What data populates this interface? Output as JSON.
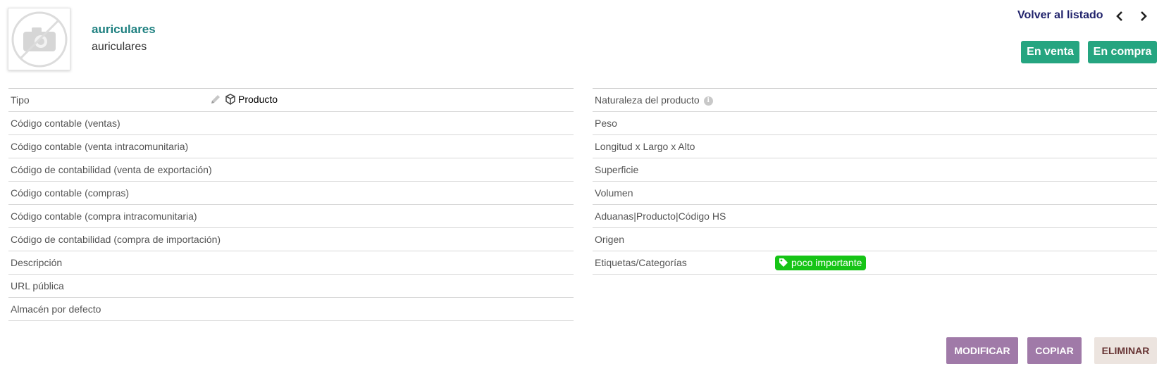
{
  "header": {
    "ref": "auriculares",
    "label": "auriculares",
    "back_link": "Volver al listado",
    "status_sell": "En venta",
    "status_buy": "En compra"
  },
  "left_fields": [
    {
      "label": "Tipo",
      "value": "Producto"
    },
    {
      "label": "Código contable (ventas)",
      "value": ""
    },
    {
      "label": "Código contable (venta intracomunitaria)",
      "value": ""
    },
    {
      "label": "Código de contabilidad (venta de exportación)",
      "value": ""
    },
    {
      "label": "Código contable (compras)",
      "value": ""
    },
    {
      "label": "Código contable (compra intracomunitaria)",
      "value": ""
    },
    {
      "label": "Código de contabilidad (compra de importación)",
      "value": ""
    },
    {
      "label": "Descripción",
      "value": ""
    },
    {
      "label": "URL pública",
      "value": ""
    },
    {
      "label": "Almacén por defecto",
      "value": ""
    }
  ],
  "right_fields": [
    {
      "label": "Naturaleza del producto",
      "value": ""
    },
    {
      "label": "Peso",
      "value": ""
    },
    {
      "label": "Longitud x Largo x Alto",
      "value": ""
    },
    {
      "label": "Superficie",
      "value": ""
    },
    {
      "label": "Volumen",
      "value": ""
    },
    {
      "label": "Aduanas|Producto|Código HS",
      "value": ""
    },
    {
      "label": "Origen",
      "value": ""
    },
    {
      "label": "Etiquetas/Categorías",
      "value": "poco importante"
    }
  ],
  "actions": {
    "modify": "MODIFICAR",
    "copy": "COPIAR",
    "delete": "ELIMINAR"
  },
  "colors": {
    "ref_title": "#1e8080",
    "status_button": "#25a580",
    "action_button": "#a07aa8",
    "delete_button": "#ece4df",
    "tag": "#16c416"
  }
}
